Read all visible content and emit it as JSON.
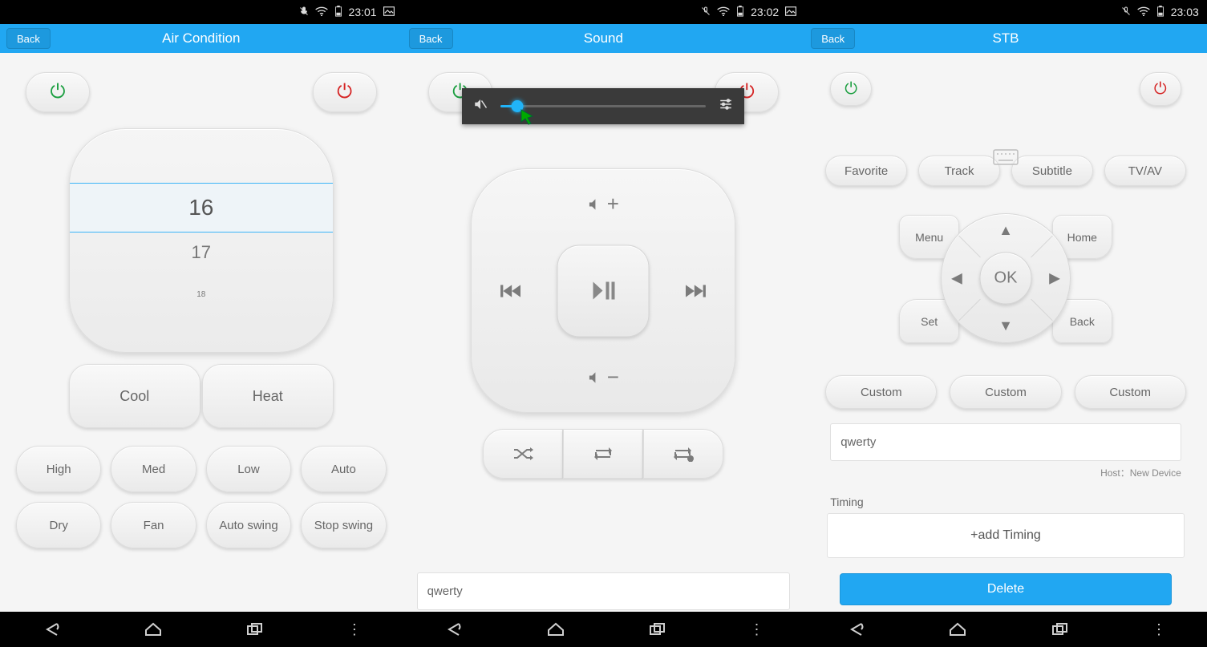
{
  "panel1": {
    "title": "Air Condition",
    "back": "Back",
    "time": "23:01",
    "temp_selected": "16",
    "temp_next": "17",
    "temp_after": "18",
    "cool": "Cool",
    "heat": "Heat",
    "fans": [
      "High",
      "Med",
      "Low",
      "Auto",
      "Dry",
      "Fan",
      "Auto swing",
      "Stop swing"
    ]
  },
  "panel2": {
    "title": "Sound",
    "back": "Back",
    "time": "23:02",
    "text": "qwerty"
  },
  "panel3": {
    "title": "STB",
    "back": "Back",
    "time": "23:03",
    "row4": [
      "Favorite",
      "Track",
      "Subtitle",
      "TV/AV"
    ],
    "corners": {
      "tl": "Menu",
      "tr": "Home",
      "bl": "Set",
      "br": "Back"
    },
    "ok": "OK",
    "customs": [
      "Custom",
      "Custom",
      "Custom"
    ],
    "text": "qwerty",
    "host": "Host：New Device",
    "timing_label": "Timing",
    "add_timing": "+add Timing",
    "delete": "Delete"
  }
}
